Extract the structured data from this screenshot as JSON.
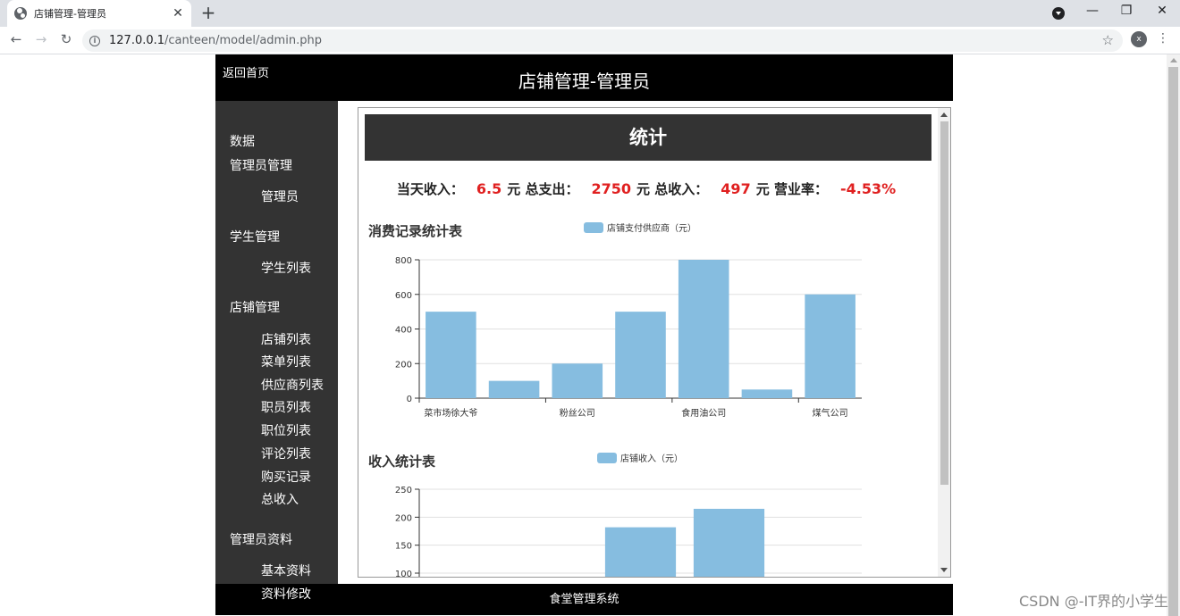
{
  "browser": {
    "tab_title": "店铺管理-管理员",
    "tab_close": "✕",
    "new_tab": "+",
    "url_host": "127.0.0.1",
    "url_path": "/canteen/model/admin.php",
    "avatar_letter": "x",
    "window_minimize": "—",
    "window_restore": "❐",
    "window_close": "✕"
  },
  "header": {
    "back_home": "返回首页",
    "title": "店铺管理-管理员"
  },
  "sidebar": {
    "groups": [
      {
        "label": "数据"
      },
      {
        "label": "管理员管理",
        "items": [
          "管理员"
        ]
      },
      {
        "label": "学生管理",
        "items": [
          "学生列表"
        ]
      },
      {
        "label": "店铺管理",
        "items": [
          "店铺列表",
          "菜单列表",
          "供应商列表",
          "职员列表",
          "职位列表",
          "评论列表",
          "购买记录",
          "总收入"
        ]
      },
      {
        "label": "管理员资料",
        "items": [
          "基本资料",
          "资料修改"
        ]
      }
    ]
  },
  "stats": {
    "heading": "统计",
    "today_income_label": "当天收入：",
    "today_income": "6.5",
    "unit": "元",
    "total_expense_label": "总支出：",
    "total_expense": "2750",
    "total_income_label": "总收入：",
    "total_income": "497",
    "rate_label": "营业率：",
    "rate": "-4.53%"
  },
  "chart_data": [
    {
      "type": "bar",
      "title": "消费记录统计表",
      "series": [
        {
          "name": "店铺支付供应商（元）",
          "values": [
            500,
            100,
            200,
            500,
            800,
            50,
            600
          ]
        }
      ],
      "categories": [
        "菜市场徐大爷",
        "",
        "粉丝公司",
        "",
        "食用油公司",
        "",
        "煤气公司"
      ],
      "tick_labels": [
        "菜市场徐大爷",
        "粉丝公司",
        "食用油公司",
        "煤气公司"
      ],
      "y_ticks": [
        0,
        200,
        400,
        600,
        800
      ],
      "ylim": [
        0,
        800
      ],
      "color": "#86bde0",
      "grid": true,
      "legend": "top-center"
    },
    {
      "type": "bar",
      "title": "收入统计表",
      "series": [
        {
          "name": "店铺收入（元）",
          "values": [
            0,
            0,
            182,
            215,
            0
          ]
        }
      ],
      "y_ticks": [
        100,
        150,
        200,
        250
      ],
      "ylim": [
        100,
        250
      ],
      "color": "#86bde0",
      "grid": true,
      "legend": "top-center"
    }
  ],
  "footer": {
    "text": "食堂管理系统"
  },
  "watermark": "CSDN @-IT界的小学生"
}
